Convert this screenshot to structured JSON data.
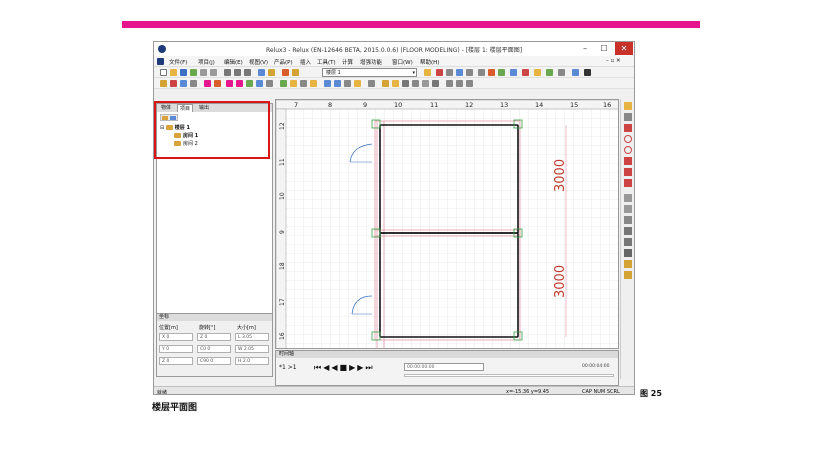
{
  "window": {
    "title": "Relux3 - Relux (EN-12646 BETA, 2015.0.0.6) (FLOOR MODELING) - [楼层 1: 楼层平面图]"
  },
  "menu": [
    "文件(F)",
    "项目(j)",
    "编辑(E)",
    "视图(V)",
    "产品(P)",
    "插入",
    "工具(T)",
    "计算",
    "增强功能",
    "窗口(W)",
    "帮助(H)"
  ],
  "toolbar": {
    "floor_select": "楼层 1"
  },
  "left_panel": {
    "tabs": [
      "物体",
      "项目",
      "输出"
    ],
    "tree": {
      "root": "楼层 1",
      "children": [
        "房间 1",
        "房间 2"
      ]
    }
  },
  "properties": {
    "header": "坐标",
    "col_labels": [
      "位置[m]",
      "旋转[°]",
      "大小[m]"
    ],
    "rows": [
      [
        "X 0",
        "Z 0",
        "L 3.05"
      ],
      [
        "Y 0",
        "C0 0",
        "W 2.05"
      ],
      [
        "Z 0",
        "C90 0",
        "H 2.0"
      ]
    ]
  },
  "ruler": {
    "top": [
      "7",
      "8",
      "9",
      "10",
      "11",
      "12",
      "13",
      "14",
      "15",
      "16"
    ],
    "left": [
      "12",
      "11",
      "10",
      "9",
      "18",
      "17",
      "16"
    ]
  },
  "dimensions": [
    "3000",
    "3000"
  ],
  "timeline": {
    "header": "时间轴",
    "left_label": "*1  >1",
    "time_start": "00:00:00:00",
    "time_end": "00:00:04:00"
  },
  "statusbar": {
    "left": "就绪",
    "coords": "x=-15.36 y=9.45",
    "flags": "CAP  NUM  SCRL"
  },
  "figure_label": "图 25",
  "caption": "楼层平面图",
  "colors": {
    "accent_bar": "#e6168c",
    "highlight_box": "#d91515",
    "dimension_text": "#c0392b",
    "wall": "#111111"
  }
}
